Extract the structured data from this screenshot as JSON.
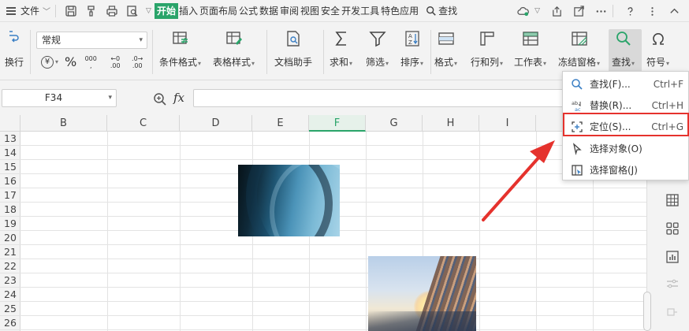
{
  "menubar": {
    "file_label": "文件",
    "tabs": [
      {
        "label": "开始",
        "active": true
      },
      {
        "label": "插入"
      },
      {
        "label": "页面布局"
      },
      {
        "label": "公式"
      },
      {
        "label": "数据"
      },
      {
        "label": "审阅"
      },
      {
        "label": "视图"
      },
      {
        "label": "安全"
      },
      {
        "label": "开发工具"
      },
      {
        "label": "特色应用"
      }
    ],
    "search_label": "查找"
  },
  "ribbon": {
    "wrap_label": "换行",
    "number_format": "常规",
    "currency_symbol": "¥",
    "percent_symbol": "%",
    "thousands_symbol": "000",
    "inc_decimal": ".00",
    "dec_decimal": ".00",
    "items": {
      "cond_format": "条件格式",
      "table_style": "表格样式",
      "doc_helper": "文档助手",
      "sum": "求和",
      "filter": "筛选",
      "sort": "排序",
      "format": "格式",
      "rowcol": "行和列",
      "sheet": "工作表",
      "freeze": "冻结窗格",
      "find": "查找",
      "symbol": "符号"
    }
  },
  "formula_bar": {
    "name_box": "F34",
    "fx_label": "fx",
    "value": ""
  },
  "grid": {
    "columns": [
      "B",
      "C",
      "D",
      "E",
      "F",
      "G",
      "H",
      "I"
    ],
    "selected_column": "F",
    "rows": [
      "13",
      "14",
      "15",
      "16",
      "17",
      "18",
      "19",
      "20",
      "21",
      "22",
      "23",
      "24",
      "25",
      "26"
    ]
  },
  "find_menu": {
    "items": [
      {
        "label": "查找(F)...",
        "shortcut": "Ctrl+F"
      },
      {
        "label": "替换(R)...",
        "shortcut": "Ctrl+H"
      },
      {
        "label": "定位(S)...",
        "shortcut": "Ctrl+G",
        "highlighted": true
      },
      {
        "label": "选择对象(O)",
        "shortcut": ""
      },
      {
        "label": "选择窗格(J)",
        "shortcut": ""
      }
    ]
  },
  "colors": {
    "accent": "#2aa46a",
    "highlight": "#e5322d"
  }
}
